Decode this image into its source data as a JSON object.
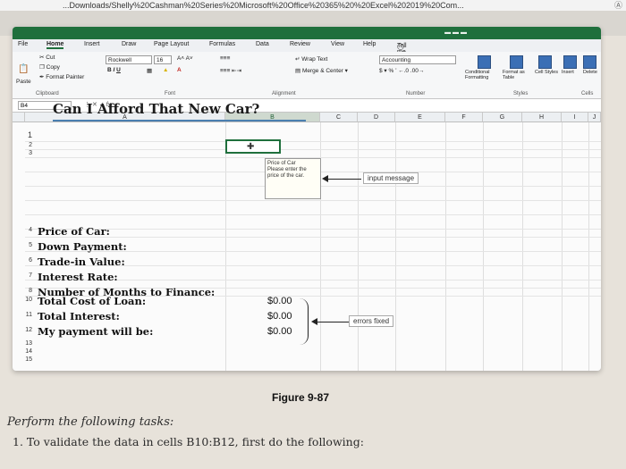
{
  "browser": {
    "url": "...Downloads/Shelly%20Cashman%20Series%20Microsoft%20Office%20365%20%20Excel%202019%20Com..."
  },
  "excel": {
    "ribbon_tabs": [
      "File",
      "Home",
      "Insert",
      "Draw",
      "Page Layout",
      "Formulas",
      "Data",
      "Review",
      "View",
      "Help"
    ],
    "active_tab": "Home",
    "tell_me": "Tell me what you want to do",
    "font_name": "Rockwell",
    "font_size": "16",
    "number_format": "Accounting",
    "clipboard": {
      "paste": "Paste",
      "cut": "Cut",
      "copy": "Copy",
      "format_painter": "Format Painter",
      "group": "Clipboard"
    },
    "groups": {
      "font": "Font",
      "alignment": "Alignment",
      "number": "Number",
      "styles": "Styles",
      "cells": "Cells"
    },
    "buttons": {
      "wrap_text": "Wrap Text",
      "merge_center": "Merge & Center",
      "conditional": "Conditional Formatting",
      "format_as_table": "Format as Table",
      "cell_styles": "Cell Styles",
      "insert": "Insert",
      "delete": "Delete"
    },
    "name_box": "B4",
    "formula_fx": "fx",
    "columns": [
      "A",
      "B",
      "C",
      "D",
      "E",
      "F",
      "G",
      "H",
      "I",
      "J"
    ],
    "sheet_title": "Can I Afford That New Car?",
    "rows": [
      {
        "num": "4",
        "label": "Price of Car:"
      },
      {
        "num": "5",
        "label": "Down Payment:"
      },
      {
        "num": "6",
        "label": "Trade-in Value:"
      },
      {
        "num": "7",
        "label": "Interest Rate:"
      },
      {
        "num": "8",
        "label": "Number of Months to Finance:"
      }
    ],
    "results": [
      {
        "num": "10",
        "label": "Total Cost of Loan:",
        "value": "$0.00"
      },
      {
        "num": "11",
        "label": "Total Interest:",
        "value": "$0.00"
      },
      {
        "num": "12",
        "label": "My payment will be:",
        "value": "$0.00"
      }
    ],
    "input_message": {
      "title": "Price of Car",
      "body": "Please enter the price of the car."
    }
  },
  "callouts": {
    "input_message": "input message",
    "errors_fixed": "errors fixed"
  },
  "figure_caption": "Figure 9-87",
  "instructions": {
    "heading": "Perform the following tasks:",
    "step1": "1. To validate the data in cells B10:B12, first do the following:"
  },
  "colors": {
    "excel_green": "#1f6f3c",
    "accent_blue": "#4a7fb0"
  }
}
